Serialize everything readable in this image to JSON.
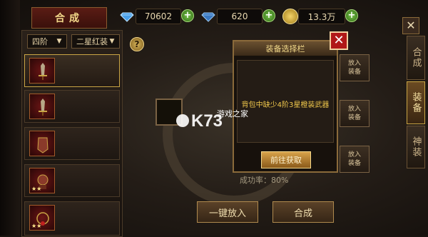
{
  "header": {
    "title": "合成",
    "diamond_count": "70602",
    "bound_diamond_count": "620",
    "gold_count": "13.3万"
  },
  "filters": {
    "tier": "四阶",
    "quality": "二星红装"
  },
  "equipment_list": [
    {
      "name": "",
      "selected": true,
      "star": false
    },
    {
      "name": "",
      "selected": false,
      "star": false
    },
    {
      "name": "",
      "selected": false,
      "star": false
    },
    {
      "name": "",
      "selected": false,
      "star": true
    },
    {
      "name": "",
      "selected": false,
      "star": true
    }
  ],
  "main": {
    "put_in_label": "放入\n装备",
    "success_rate": "成功率：80%",
    "auto_put_button": "一键放入",
    "compose_button": "合成"
  },
  "right_tabs": [
    "合成",
    "装备",
    "神装"
  ],
  "dialog": {
    "title": "装备选择栏",
    "message": "背包中缺少4阶3星橙装武器",
    "go_button": "前往获取"
  },
  "watermark": {
    "brand": "K73",
    "sub": "游戏之家"
  },
  "colors": {
    "accent_gold": "#f3d98a",
    "item_name_red": "#d01818",
    "dialog_message": "#f2c94c",
    "close_red": "#b01818"
  },
  "icons": {
    "diamond": "diamond-icon",
    "bound_diamond": "bound-diamond-icon",
    "gold": "gold-coin-icon",
    "plus": "plus-icon",
    "help": "question-icon",
    "close": "close-icon",
    "dropdown": "triangle-down-icon"
  }
}
